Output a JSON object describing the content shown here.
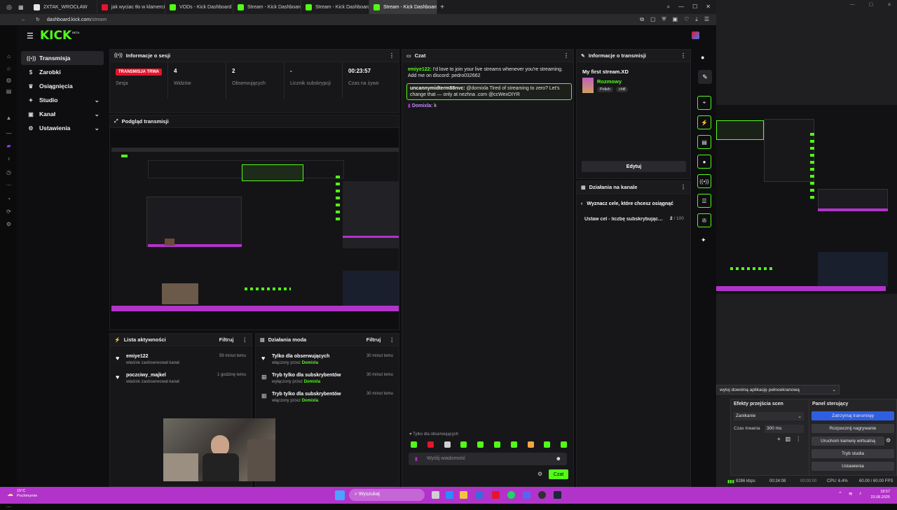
{
  "browser": {
    "tabs": [
      {
        "label": "2XTAK_WROCŁAW",
        "color": "#e6e6e6",
        "icon": "k-icon"
      },
      {
        "label": "jak wyciac tło w klamercie",
        "color": "#e5152b",
        "icon": "youtube-icon"
      },
      {
        "label": "VODs - Kick Dashboard",
        "color": "#53fc18",
        "icon": "kick-icon"
      },
      {
        "label": "Stream - Kick Dashboard",
        "color": "#53fc18",
        "icon": "kick-icon"
      },
      {
        "label": "Stream - Kick Dashboard",
        "color": "#53fc18",
        "icon": "kick-icon"
      },
      {
        "label": "Stream - Kick Dashboard",
        "color": "#53fc18",
        "icon": "kick-icon"
      }
    ],
    "url_domain": "dashboard.kick.com",
    "url_path": "/stream"
  },
  "kick": {
    "logo": "KICK",
    "logo_sup": "BETA",
    "accent": "#53fc18"
  },
  "nav": {
    "items": [
      {
        "label": "Transmisja",
        "icon": "broadcast-icon",
        "active": true
      },
      {
        "label": "Zarobki",
        "icon": "money-icon"
      },
      {
        "label": "Osiągnięcia",
        "icon": "trophy-icon"
      },
      {
        "label": "Studio",
        "icon": "gear-icon",
        "chev": "⌄"
      },
      {
        "label": "Kanał",
        "icon": "channel-icon",
        "chev": "⌄"
      },
      {
        "label": "Ustawienia",
        "icon": "settings-icon",
        "chev": "⌄"
      }
    ]
  },
  "session": {
    "title": "Informacje o sesji",
    "badge": "TRANSMISJA TRWA",
    "badge_label": "Sesja",
    "stats": [
      {
        "value": "4",
        "label": "Widzów"
      },
      {
        "value": "2",
        "label": "Obserwujących"
      },
      {
        "value": "-",
        "label": "Licznik subskrypcji"
      },
      {
        "value": "00:23:57",
        "label": "Czas na żywo"
      }
    ]
  },
  "preview": {
    "title": "Podgląd transmisji"
  },
  "activity": {
    "title": "Lista aktywności",
    "filter": "Filtruj",
    "items": [
      {
        "name": "emiye122",
        "sub": "właśnie zaobserwował kanał",
        "time": "59 minut temu"
      },
      {
        "name": "poczciwy_majkel",
        "sub": "właśnie zaobserwował kanał",
        "time": "1 godzinę temu"
      }
    ]
  },
  "mod": {
    "title": "Działania moda",
    "filter": "Filtruj",
    "items": [
      {
        "name": "Tylko dla obserwujących",
        "sub": "włączony przez",
        "by": "Domixla",
        "time": "30 minut temu"
      },
      {
        "name": "Tryb tylko dla subskrybentów",
        "sub": "wyłączony przez",
        "by": "Domixla",
        "time": "30 minut temu"
      },
      {
        "name": "Tryb tylko dla subskrybentów",
        "sub": "włączony przez",
        "by": "Domixla",
        "time": "30 minut temu"
      }
    ]
  },
  "chat": {
    "title": "Czat",
    "msg1_user": "emiye122:",
    "msg1_text": " I'd love to join your live streams whenever you're streaming. Add me on discord: pedro032662",
    "msg2_user": "uncannymidterm88nvc:",
    "msg2_text": " @domixla Tired of streaming to zero? Let's change that — only at nezhna .com @ccWexDIYR",
    "msg3_user": "Domixla:",
    "msg3_text": " k",
    "mode_label": "Tylko dla obserwujących",
    "input_placeholder": "Wyślij wiadomość",
    "send_label": "Czat"
  },
  "stream_info": {
    "title": "Informacje o transmisji",
    "stream_title": "My first stream.XD",
    "category": "Rozmowy",
    "tags": [
      "Polish",
      "chill"
    ],
    "edit_label": "Edytuj"
  },
  "channel_actions": {
    "title": "Działania na kanale",
    "goal_header": "Wyznacz cele, które chcesz osiągnąć",
    "goal_item": "Ustaw cel - liczbę subskrybujących",
    "goal_progress_current": "2",
    "goal_progress_total": "/ 100"
  },
  "obs": {
    "fullscreen_select": "wytuj dowolną aplikację pełnoekranową",
    "transitions_title": "Efekty przejścia scen",
    "transition_value": "Zanikanie",
    "duration_label": "Czas trwania",
    "duration_value": "300 ms",
    "control_title": "Panel sterujący",
    "buttons": [
      "Zatrzymaj transmisję",
      "Rozpocznij nagrywanie",
      "Uruchom kamerę wirtualną",
      "Tryb studia",
      "Ustawienia"
    ],
    "status_bitrate": "8286 kbps",
    "status_live": "00:24:08",
    "status_rec": "00:00:00",
    "status_cpu": "CPU: 6.4%",
    "status_fps": "60.00 / 60.00 FPS"
  },
  "taskbar": {
    "weather_temp": "15°C",
    "weather_desc": "Pochmurnie",
    "search_label": "Wyszukaj",
    "time": "18:57",
    "date": "23.08.2025",
    "color": "#b233c9"
  }
}
